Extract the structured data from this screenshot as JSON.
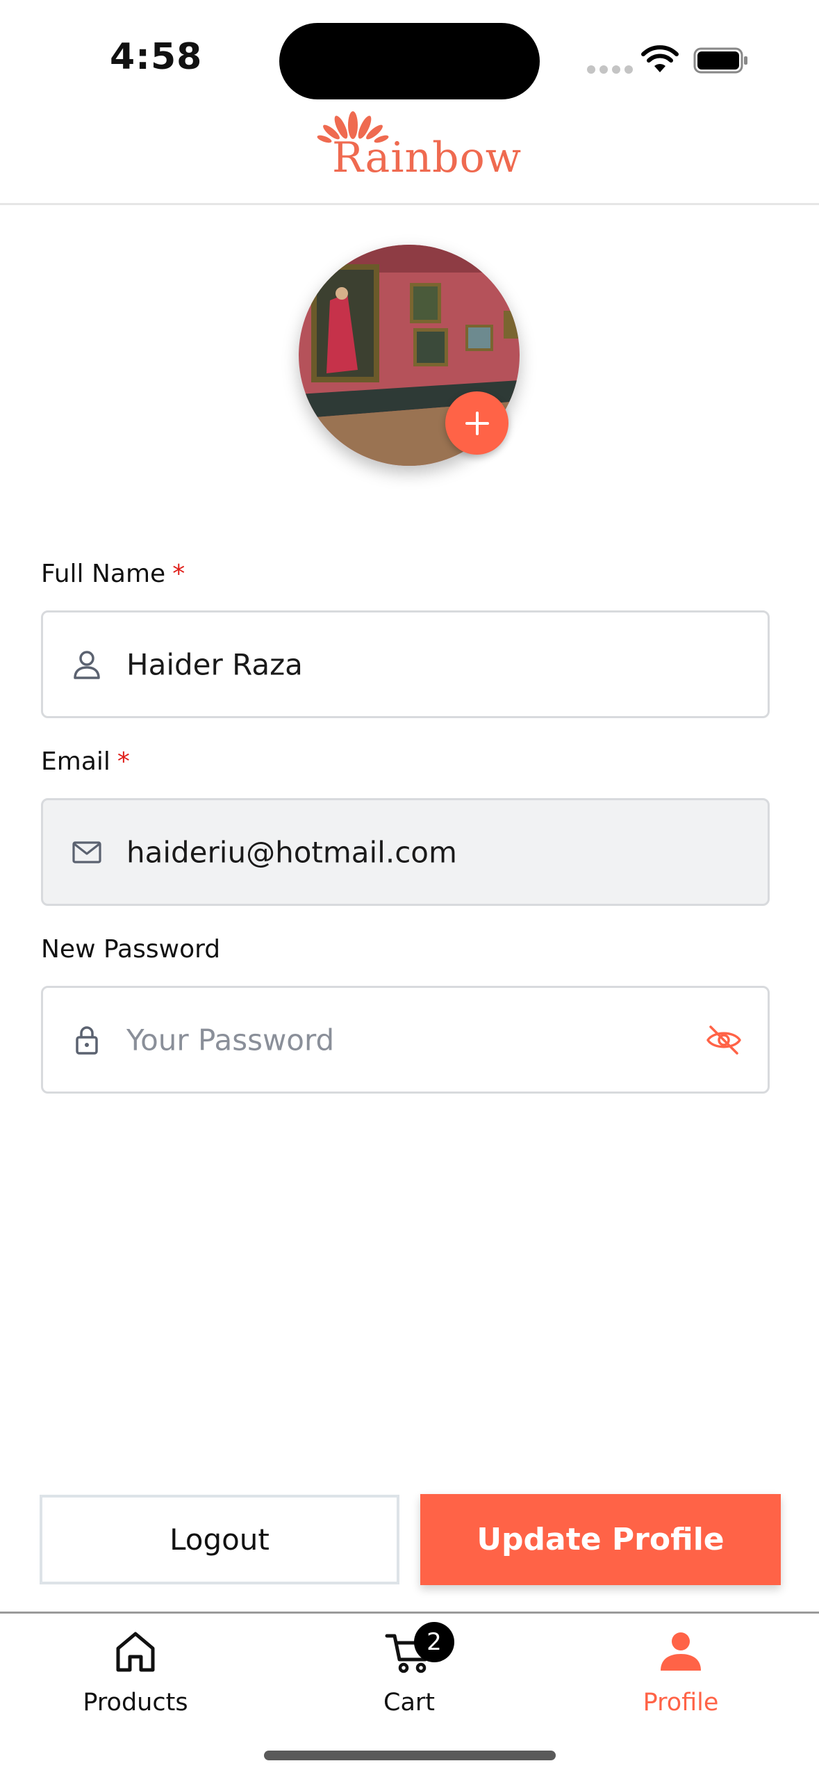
{
  "status_bar": {
    "time": "4:58"
  },
  "brand": {
    "name": "Rainbow",
    "color": "#ef6a50"
  },
  "profile": {
    "full_name_label": "Full Name",
    "full_name_value": "Haider Raza",
    "email_label": "Email",
    "email_value": "haideriu@hotmail.com",
    "password_label": "New Password",
    "password_placeholder": "Your Password",
    "required_mark": "*"
  },
  "actions": {
    "logout_label": "Logout",
    "update_label": "Update Profile"
  },
  "tabs": [
    {
      "label": "Products",
      "icon": "home-icon"
    },
    {
      "label": "Cart",
      "icon": "cart-icon",
      "badge": "2"
    },
    {
      "label": "Profile",
      "icon": "person-icon",
      "active": true
    }
  ],
  "colors": {
    "accent": "#ff6347",
    "required": "#e0201b",
    "border": "#d8dadd"
  }
}
